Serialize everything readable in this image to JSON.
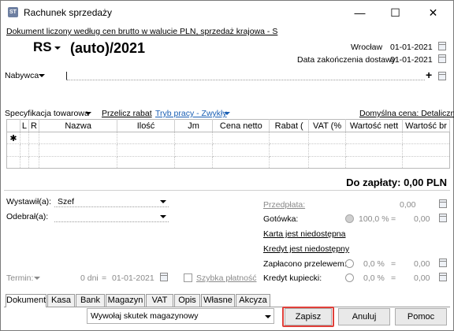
{
  "window": {
    "title": "Rachunek sprzedaży",
    "minimize": "—",
    "maximize": "☐",
    "close": "✕"
  },
  "header": {
    "info_link": "Dokument liczony według cen brutto w walucie PLN, sprzedaż krajowa - S",
    "doc_type": "RS",
    "doc_number": "(auto)/2021",
    "place": "Wrocław",
    "date": "01-01-2021",
    "delivery_label": "Data zakończenia dostawy",
    "delivery_date": "01-01-2021"
  },
  "buyer": {
    "label": "Nabywca",
    "value": "|",
    "add": "+"
  },
  "spec": {
    "label": "Specyfikacja towarowa",
    "recalc": "Przelicz rabat",
    "mode": "Tryb pracy - Zwykły",
    "price_label": "Domyślna cena: Detaliczna"
  },
  "grid": {
    "columns": [
      "L",
      "R",
      "Nazwa",
      "Ilość",
      "Jm",
      "Cena netto",
      "Rabat (",
      "VAT (%",
      "Wartość nett",
      "Wartość br"
    ],
    "new_row_marker": "✱"
  },
  "total": {
    "label": "Do zapłaty: 0,00 PLN"
  },
  "issuer": {
    "label": "Wystawił(a):",
    "value": "Szef"
  },
  "receiver": {
    "label": "Odebrał(a):",
    "value": ""
  },
  "payments": {
    "prepayment": {
      "label": "Przedpłata:",
      "value": "0,00"
    },
    "cash": {
      "label": "Gotówka:",
      "percent": "100,0 %",
      "value": "0,00"
    },
    "card": "Karta jest niedostępna",
    "credit": "Kredyt jest niedostępny",
    "transfer": {
      "label": "Zapłacono przelewem:",
      "percent": "0,0 %",
      "value": "0,00"
    },
    "merchant": {
      "label": "Kredyt kupiecki:",
      "percent": "0,0 %",
      "value": "0,00"
    },
    "eq": "="
  },
  "term": {
    "label": "Termin:",
    "days": "0 dni",
    "eq": "=",
    "date": "01-01-2021",
    "quick": "Szybka płatność"
  },
  "tabs": [
    "Dokument",
    "Kasa",
    "Bank",
    "Magazyn",
    "VAT",
    "Opis",
    "Własne",
    "Akcyza"
  ],
  "footer": {
    "effect": "Wywołaj skutek magazynowy",
    "save": "Zapisz",
    "cancel": "Anuluj",
    "help": "Pomoc"
  },
  "colors": {
    "link": "#0645ad",
    "accent_border": "#e0403a",
    "mode_link": "#1a5fb4"
  }
}
